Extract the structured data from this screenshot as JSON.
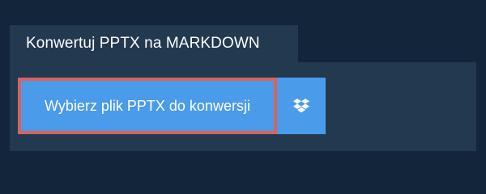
{
  "header": {
    "title": "Konwertuj PPTX na MARKDOWN"
  },
  "upload": {
    "choose_label": "Wybierz plik PPTX do konwersji",
    "dropbox_icon": "dropbox-icon"
  },
  "colors": {
    "background": "#13253a",
    "panel": "#233950",
    "button": "#4a9bea",
    "highlight_border": "#d9625c",
    "text": "#ffffff"
  }
}
